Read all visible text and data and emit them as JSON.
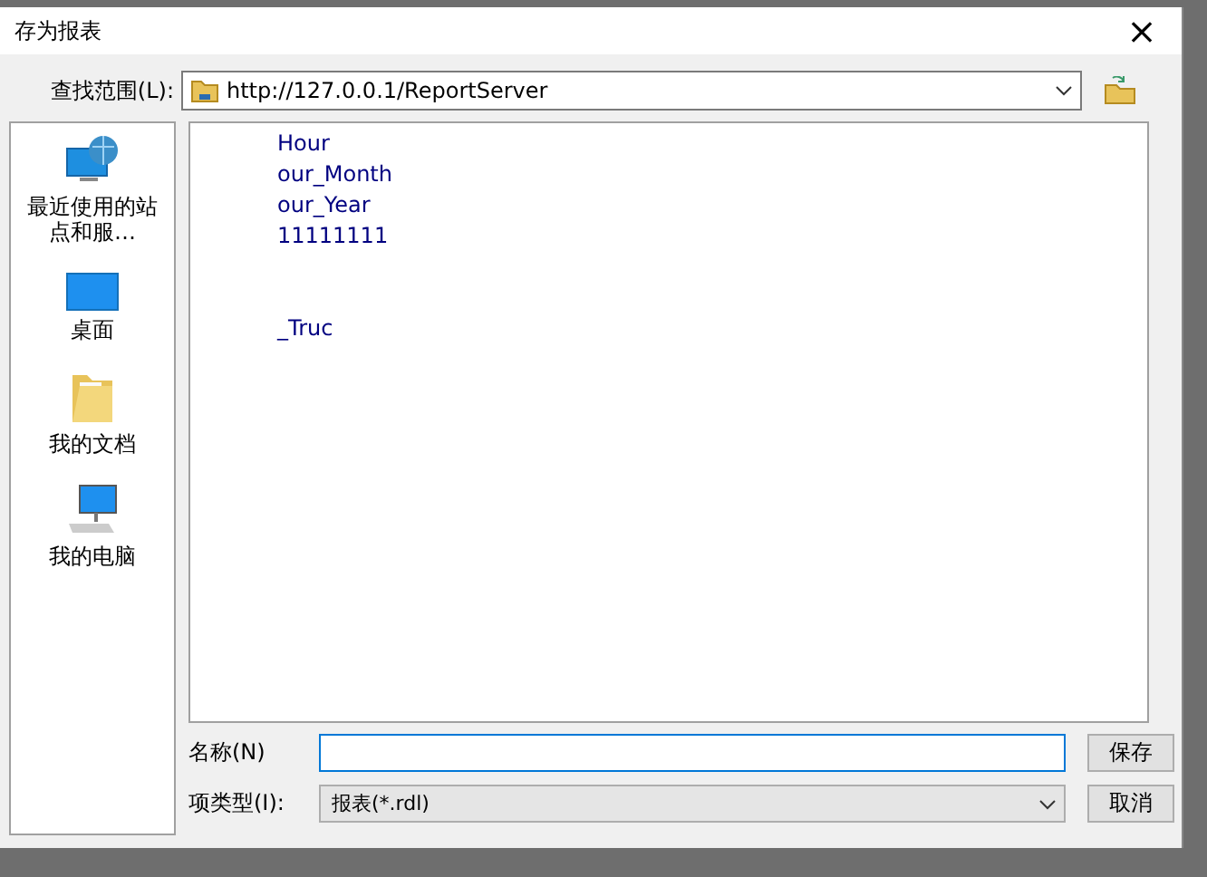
{
  "window": {
    "title": "存为报表",
    "close": "×"
  },
  "look_in": {
    "label": "查找范围(L):",
    "value": "http://127.0.0.1/ReportServer"
  },
  "places": [
    {
      "label": "最近使用的站点和服…",
      "kind": "recent"
    },
    {
      "label": "桌面",
      "kind": "desktop"
    },
    {
      "label": "我的文档",
      "kind": "documents"
    },
    {
      "label": "我的电脑",
      "kind": "computer"
    }
  ],
  "files": [
    "Hour",
    "our_Month",
    "our_Year",
    "11111111",
    "_Truc"
  ],
  "name_field": {
    "label": "名称(N)"
  },
  "type_field": {
    "label": "项类型(I):",
    "value": "报表(*.rdl)"
  },
  "buttons": [
    "保存",
    "取消"
  ]
}
